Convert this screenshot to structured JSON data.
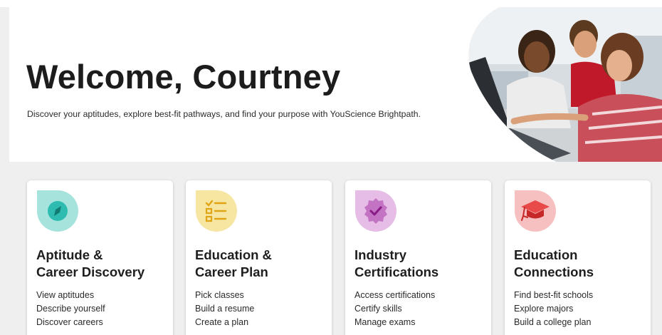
{
  "colors": {
    "aptitude_icon": "#a6e3dd",
    "education_icon": "#f6e6a2",
    "industry_icon": "#e6bde6",
    "connections_icon": "#f6c0c0"
  },
  "hero": {
    "title": "Welcome, Courtney",
    "subtitle": "Discover your aptitudes, explore best-fit pathways, and find your purpose with YouScience Brightpath."
  },
  "cards": [
    {
      "icon": "compass-icon",
      "title_line1": "Aptitude &",
      "title_line2": "Career Discovery",
      "links": [
        "View aptitudes",
        "Describe yourself",
        "Discover careers"
      ]
    },
    {
      "icon": "checklist-icon",
      "title_line1": "Education &",
      "title_line2": "Career Plan",
      "links": [
        "Pick classes",
        "Build a resume",
        "Create a plan"
      ]
    },
    {
      "icon": "certificate-badge-icon",
      "title_line1": "Industry",
      "title_line2": "Certifications",
      "links": [
        "Access certifications",
        "Certify skills",
        "Manage exams"
      ]
    },
    {
      "icon": "graduation-cap-icon",
      "title_line1": "Education",
      "title_line2": "Connections",
      "links": [
        "Find best-fit schools",
        "Explore majors",
        "Build a college plan"
      ]
    }
  ]
}
